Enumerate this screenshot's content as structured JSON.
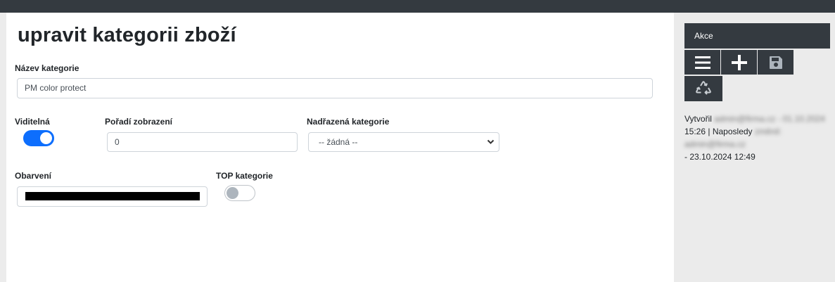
{
  "page": {
    "title": "upravit kategorii zboží"
  },
  "form": {
    "name_label": "Název kategorie",
    "name_value": "PM color protect",
    "visible_label": "Viditelná",
    "visible_on": true,
    "order_label": "Pořadí zobrazení",
    "order_value": "0",
    "parent_label": "Nadřazená kategorie",
    "parent_selected": "-- žádná --",
    "color_label": "Obarvení",
    "color_value": "#000000",
    "top_label": "TOP kategorie",
    "top_on": false
  },
  "sidebar": {
    "header": "Akce",
    "buttons": [
      {
        "icon": "list-icon"
      },
      {
        "icon": "plus-icon"
      },
      {
        "icon": "save-icon"
      },
      {
        "icon": "recycle-icon"
      }
    ],
    "meta": {
      "created_prefix": "Vytvořil",
      "created_blurred": "admin@firma.cz - 01.10.2024",
      "created_time": "15:26",
      "separator": "|",
      "modified_prefix": "Naposledy",
      "modified_blurred": "změnil: admin@firma.cz",
      "modified_date": "- 23.10.2024 12:49"
    }
  },
  "colors": {
    "topbar": "#343a40",
    "accent": "#0d6efd",
    "sidebar_bg": "#ebebeb"
  }
}
